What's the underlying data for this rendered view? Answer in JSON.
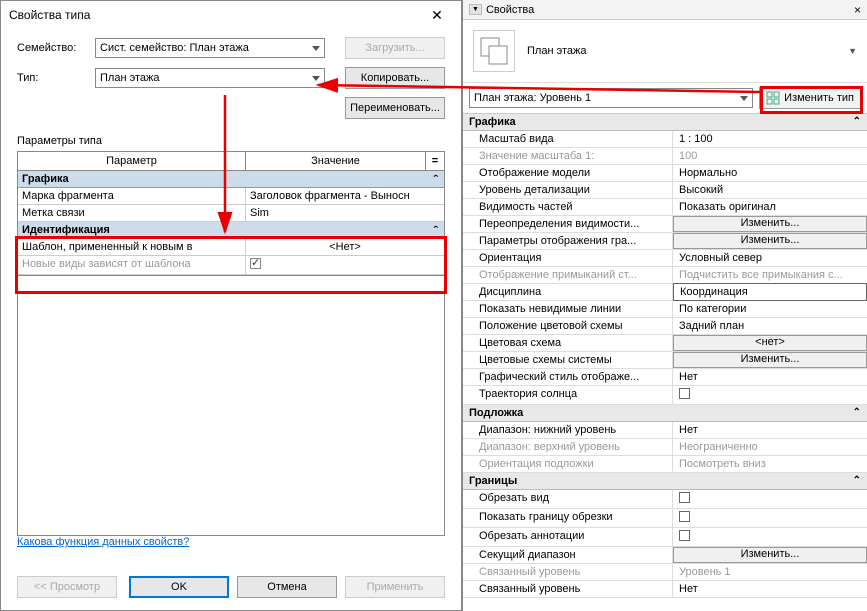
{
  "dialog": {
    "title": "Свойства типа",
    "family_label": "Семейство:",
    "family_value": "Сист. семейство: План этажа",
    "type_label": "Тип:",
    "type_value": "План этажа",
    "load_btn": "Загрузить...",
    "copy_btn": "Копировать...",
    "rename_btn": "Переименовать...",
    "params_label": "Параметры типа",
    "col_param": "Параметр",
    "col_value": "Значение",
    "col_eq": "=",
    "groups": [
      {
        "name": "Графика",
        "rows": [
          {
            "label": "Марка фрагмента",
            "value": "Заголовок фрагмента - Выносн"
          },
          {
            "label": "Метка связи",
            "value": "Sim"
          }
        ]
      },
      {
        "name": "Идентификация",
        "rows": [
          {
            "label": "Шаблон, примененный к новым в",
            "value": "<Нет>",
            "center": true
          },
          {
            "label": "Новые виды зависят от шаблона",
            "value": "",
            "checkbox": true,
            "checked": true,
            "disabled": true
          }
        ]
      }
    ],
    "help_link": "Какова функция данных свойств?",
    "preview_btn": "<< Просмотр",
    "ok_btn": "OK",
    "cancel_btn": "Отмена",
    "apply_btn": "Применить"
  },
  "panel": {
    "title": "Свойства",
    "type_name": "План этажа",
    "instance": "План этажа: Уровень 1",
    "edit_type": "Изменить тип",
    "groups": [
      {
        "name": "Графика",
        "rows": [
          {
            "label": "Масштаб вида",
            "value": "1 : 100"
          },
          {
            "label": "Значение масштаба    1:",
            "value": "100",
            "dim": true
          },
          {
            "label": "Отображение модели",
            "value": "Нормально"
          },
          {
            "label": "Уровень детализации",
            "value": "Высокий"
          },
          {
            "label": "Видимость частей",
            "value": "Показать оригинал"
          },
          {
            "label": "Переопределения видимости...",
            "value": "Изменить...",
            "btn": true
          },
          {
            "label": "Параметры отображения гра...",
            "value": "Изменить...",
            "btn": true
          },
          {
            "label": "Ориентация",
            "value": "Условный север"
          },
          {
            "label": "Отображение примыканий ст...",
            "value": "Подчистить все примыкания с...",
            "dim": true
          },
          {
            "label": "Дисциплина",
            "value": "Координация",
            "boxed": true
          },
          {
            "label": "Показать невидимые линии",
            "value": "По категории"
          },
          {
            "label": "Положение цветовой схемы",
            "value": "Задний план"
          },
          {
            "label": "Цветовая схема",
            "value": "<нет>",
            "btn": true
          },
          {
            "label": "Цветовые схемы системы",
            "value": "Изменить...",
            "btn": true
          },
          {
            "label": "Графический стиль отображе...",
            "value": "Нет"
          },
          {
            "label": "Траектория солнца",
            "value": "",
            "checkbox": true
          }
        ]
      },
      {
        "name": "Подложка",
        "rows": [
          {
            "label": "Диапазон: нижний уровень",
            "value": "Нет"
          },
          {
            "label": "Диапазон: верхний уровень",
            "value": "Неограниченно",
            "dim": true
          },
          {
            "label": "Ориентация подложки",
            "value": "Посмотреть вниз",
            "dim": true
          }
        ]
      },
      {
        "name": "Границы",
        "rows": [
          {
            "label": "Обрезать вид",
            "value": "",
            "checkbox": true
          },
          {
            "label": "Показать границу обрезки",
            "value": "",
            "checkbox": true
          },
          {
            "label": "Обрезать аннотации",
            "value": "",
            "checkbox": true
          },
          {
            "label": "Секущий диапазон",
            "value": "Изменить...",
            "btn": true
          },
          {
            "label": "Связанный уровень",
            "value": "Уровень 1",
            "dim": true
          },
          {
            "label": "Связанный уровень",
            "value": "Нет"
          }
        ]
      }
    ]
  }
}
